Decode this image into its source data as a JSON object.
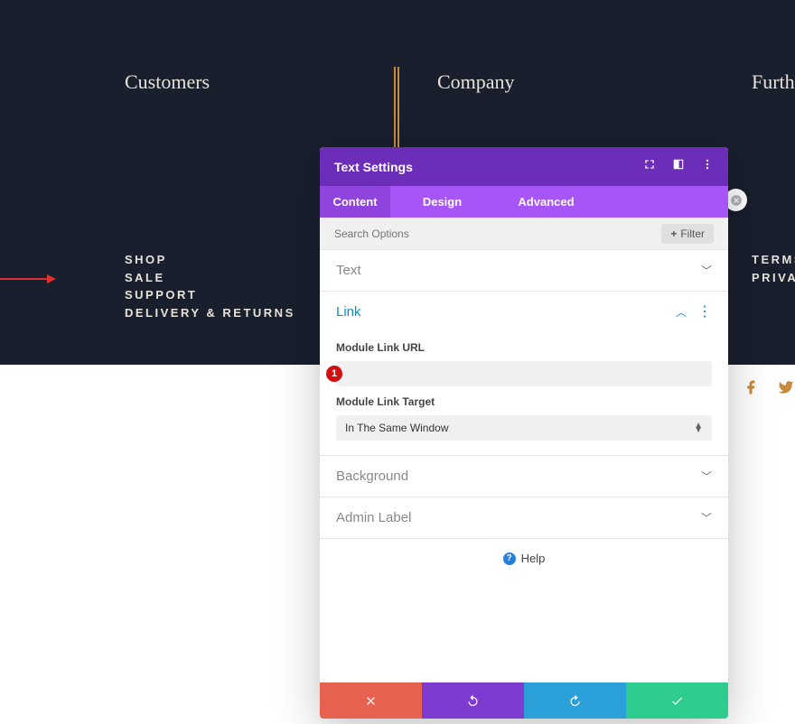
{
  "footer": {
    "customers": {
      "heading": "Customers",
      "links": [
        "SHOP",
        "SALE",
        "SUPPORT",
        "DELIVERY & RETURNS"
      ]
    },
    "company": {
      "heading": "Company"
    },
    "further": {
      "heading": "Furth",
      "links": [
        "TERMS",
        "PRIVAC"
      ]
    }
  },
  "panel": {
    "title": "Text Settings",
    "tabs": {
      "content": "Content",
      "design": "Design",
      "advanced": "Advanced"
    },
    "search": {
      "placeholder": "Search Options",
      "filter": "Filter"
    },
    "sections": {
      "text": "Text",
      "link": {
        "title": "Link",
        "url_label": "Module Link URL",
        "url_value": "",
        "target_label": "Module Link Target",
        "target_value": "In The Same Window"
      },
      "background": "Background",
      "admin_label": "Admin Label"
    },
    "help": "Help",
    "badge": "1"
  }
}
